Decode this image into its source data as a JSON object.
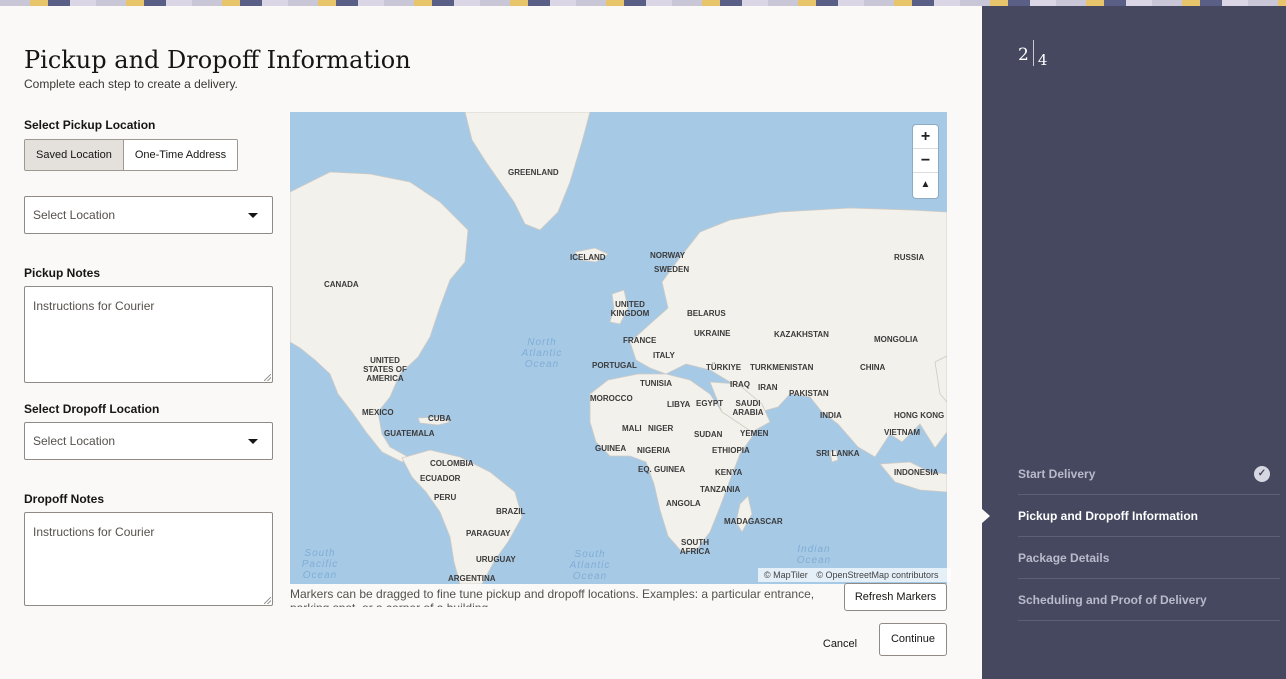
{
  "header": {
    "title": "Pickup and Dropoff Information",
    "subtitle": "Complete each step to create a delivery."
  },
  "pickup": {
    "section_label": "Select Pickup Location",
    "toggle": {
      "saved": "Saved Location",
      "one_time": "One-Time Address",
      "selected": "Saved Location"
    },
    "location_placeholder": "Select Location",
    "notes_label": "Pickup Notes",
    "notes_placeholder": "Instructions for Courier"
  },
  "dropoff": {
    "section_label": "Select Dropoff Location",
    "location_placeholder": "Select Location",
    "notes_label": "Dropoff Notes",
    "notes_placeholder": "Instructions for Courier"
  },
  "map": {
    "zoom_in": "+",
    "zoom_out": "−",
    "reset_bearing": "▲",
    "attribution": [
      "© MapTiler",
      "© OpenStreetMap contributors"
    ],
    "labels": [
      "GREENLAND",
      "ICELAND",
      "NORWAY",
      "SWEDEN",
      "RUSSIA",
      "CANADA",
      "UNITED KINGDOM",
      "BELARUS",
      "UKRAINE",
      "KAZAKHSTAN",
      "MONGOLIA",
      "FRANCE",
      "ITALY",
      "PORTUGAL",
      "TÜRKIYE",
      "TURKMENISTAN",
      "CHINA",
      "UNITED STATES OF AMERICA",
      "TUNISIA",
      "IRAQ",
      "IRAN",
      "PAKISTAN",
      "MOROCCO",
      "LIBYA",
      "EGYPT",
      "SAUDI ARABIA",
      "INDIA",
      "HONG KONG",
      "MEXICO",
      "CUBA",
      "GUATEMALA",
      "MALI",
      "NIGER",
      "SUDAN",
      "YEMEN",
      "VIETNAM",
      "GUINEA",
      "NIGERIA",
      "ETHIOPIA",
      "SRI LANKA",
      "COLOMBIA",
      "EQ. GUINEA",
      "KENYA",
      "ECUADOR",
      "INDONESIA",
      "PERU",
      "TANZANIA",
      "BRAZIL",
      "ANGOLA",
      "MADAGASCAR",
      "PARAGUAY",
      "SOUTH AFRICA",
      "URUGUAY",
      "ARGENTINA"
    ],
    "ocean_labels": [
      "North Atlantic Ocean",
      "South Pacific Ocean",
      "South Atlantic Ocean",
      "Indian Ocean"
    ]
  },
  "hint": "Markers can be dragged to fine tune pickup and dropoff locations. Examples: a particular entrance, parking spot, or a corner of a building.",
  "buttons": {
    "refresh": "Refresh Markers",
    "cancel": "Cancel",
    "continue": "Continue"
  },
  "progress": {
    "current": "2",
    "total": "4",
    "steps": [
      {
        "label": "Start Delivery",
        "state": "complete"
      },
      {
        "label": "Pickup and Dropoff Information",
        "state": "active"
      },
      {
        "label": "Package Details",
        "state": "pending"
      },
      {
        "label": "Scheduling and Proof of Delivery",
        "state": "pending"
      }
    ],
    "check_glyph": "✓"
  },
  "colors": {
    "sidebar_bg": "#45485f",
    "page_bg": "#fbf9f8",
    "ocean": "#a6c9e6",
    "land": "#f3f1ec"
  }
}
